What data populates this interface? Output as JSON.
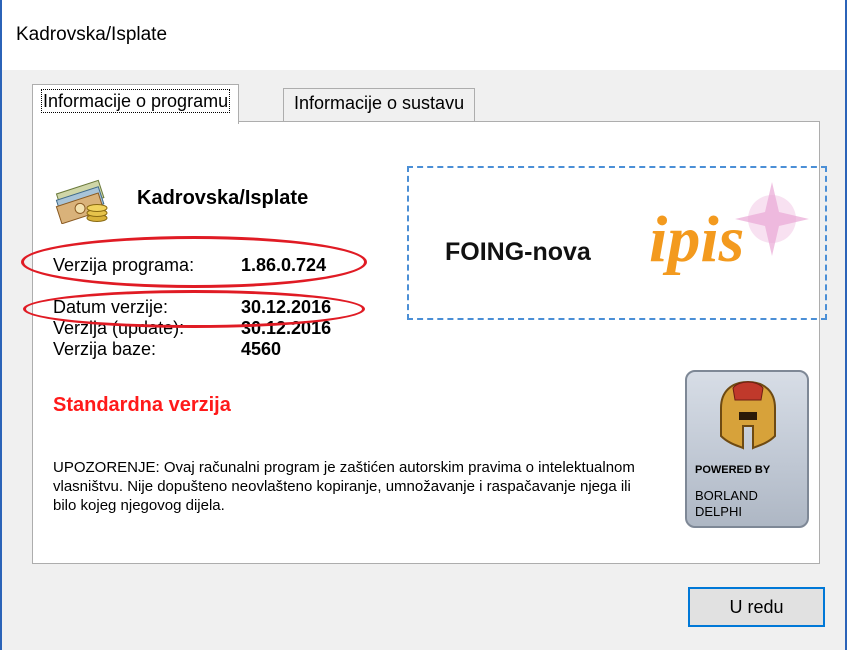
{
  "window": {
    "title": "Kadrovska/Isplate"
  },
  "tabs": [
    {
      "label": "Informacije o programu",
      "active": true
    },
    {
      "label": "Informacije o sustavu",
      "active": false
    }
  ],
  "program": {
    "name": "Kadrovska/Isplate",
    "version_label": "Verzija programa:",
    "version_value": "1.86.0.724",
    "date_label": "Datum verzije:",
    "date_value": "30.12.2016",
    "update_label": "Verzija (update):",
    "update_value": "30.12.2016",
    "db_label": "Verzija baze:",
    "db_value": "4560",
    "edition": "Standardna verzija",
    "warning": "UPOZORENJE: Ovaj računalni program je zaštićen autorskim pravima o intelektualnom vlasništvu. Nije dopušteno neovlašteno kopiranje, umnožavanje i raspačavanje njega ili bilo kojeg njegovog dijela."
  },
  "logo": {
    "company": "FOING-nova",
    "brand": "ipis"
  },
  "badge": {
    "line1": "POWERED BY",
    "line2": "BORLAND",
    "line3": "DELPHI"
  },
  "buttons": {
    "ok_label": "U redu"
  },
  "colors": {
    "accent": "#0078d7",
    "edition": "#ff1a1a",
    "annotation": "#e01b24",
    "brand_orange": "#f39a1e",
    "brand_blue": "#1f7fd1"
  },
  "icons": {
    "app": "money-stack-icon",
    "badge": "spartan-helmet-icon"
  }
}
